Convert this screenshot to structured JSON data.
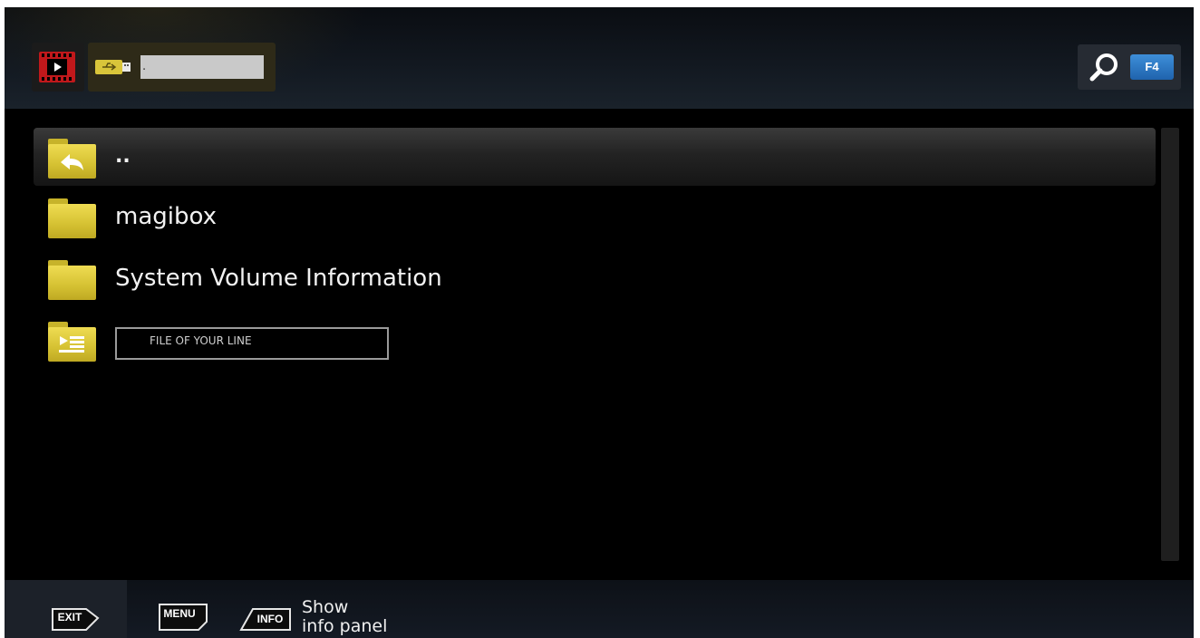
{
  "header": {
    "media_icon": "video-filmstrip-icon",
    "storage_icon": "usb-drive-icon",
    "path_value": ".",
    "search_icon": "magnifier-icon",
    "search_key": "F4"
  },
  "file_list": {
    "items": [
      {
        "name": "..",
        "icon": "folder-up-icon",
        "selected": true
      },
      {
        "name": "magibox",
        "icon": "folder-icon",
        "selected": false
      },
      {
        "name": "System Volume Information",
        "icon": "folder-icon",
        "selected": false
      },
      {
        "name": "FILE OF YOUR LINE",
        "icon": "playlist-file-icon",
        "selected": false
      }
    ]
  },
  "footer": {
    "keys": [
      {
        "label": "EXIT",
        "hint": ""
      },
      {
        "label": "MENU",
        "hint": ""
      },
      {
        "label": "INFO",
        "hint_line1": "Show",
        "hint_line2": "info panel"
      }
    ]
  },
  "colors": {
    "folder": "#d9c53a",
    "f4_key": "#2a76c5",
    "media_icon": "#c0181b"
  }
}
